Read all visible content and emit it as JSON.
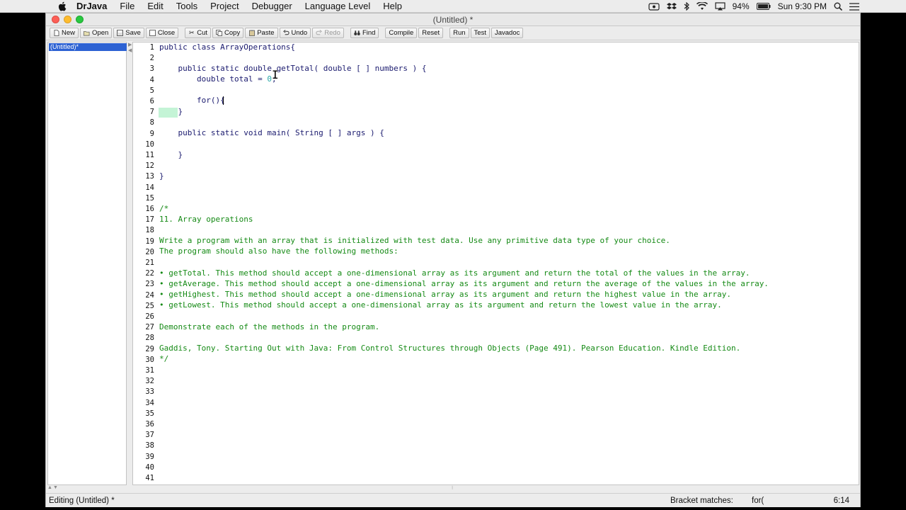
{
  "menubar": {
    "app_name": "DrJava",
    "items": [
      "File",
      "Edit",
      "Tools",
      "Project",
      "Debugger",
      "Language Level",
      "Help"
    ],
    "battery": "94%",
    "clock": "Sun 9:30 PM"
  },
  "window": {
    "title": "(Untitled) *"
  },
  "toolbar": {
    "new": "New",
    "open": "Open",
    "save": "Save",
    "close": "Close",
    "cut": "Cut",
    "copy": "Copy",
    "paste": "Paste",
    "undo": "Undo",
    "redo": "Redo",
    "find": "Find",
    "compile": "Compile",
    "reset": "Reset",
    "run": "Run",
    "test": "Test",
    "javadoc": "Javadoc"
  },
  "sidebar": {
    "documents": [
      "(Untitled)*"
    ]
  },
  "editor": {
    "line_numbers": [
      "1",
      "2",
      "3",
      "4",
      "5",
      "6",
      "7",
      "8",
      "9",
      "10",
      "11",
      "12",
      "13",
      "14",
      "15",
      "16",
      "17",
      "18",
      "19",
      "20",
      "21",
      "22",
      "23",
      "24",
      "25",
      "26",
      "27",
      "28",
      "29",
      "30",
      "31",
      "32",
      "33",
      "34",
      "35",
      "36",
      "37",
      "38",
      "39",
      "40",
      "41"
    ],
    "code": {
      "l1": "public class ArrayOperations{",
      "l3": "    public static double getTotal( double [ ] numbers ) {",
      "l4a": "        double total = ",
      "l4num": "0",
      "l4b": ";",
      "l6": "        for(){",
      "l7": "    }",
      "l9": "    public static void main( String [ ] args ) {",
      "l11": "    }",
      "l13": "}",
      "l16": "/*",
      "l17": "11. Array operations",
      "l19": "Write a program with an array that is initialized with test data. Use any primitive data type of your choice.",
      "l20": "The program should also have the following methods:",
      "l22": "• getTotal. This method should accept a one-dimensional array as its argument and return the total of the values in the array.",
      "l23": "• getAverage. This method should accept a one-dimensional array as its argument and return the average of the values in the array.",
      "l24": "• getHighest. This method should accept a one-dimensional array as its argument and return the highest value in the array.",
      "l25": "• getLowest. This method should accept a one-dimensional array as its argument and return the lowest value in the array.",
      "l27": "Demonstrate each of the methods in the program.",
      "l29": "Gaddis, Tony. Starting Out with Java: From Control Structures through Objects (Page 491). Pearson Education. Kindle Edition.",
      "l30": "*/"
    }
  },
  "statusbar": {
    "left": "Editing (Untitled) *",
    "bracket_label": "Bracket matches:",
    "bracket_value": "for(",
    "position": "6:14"
  }
}
